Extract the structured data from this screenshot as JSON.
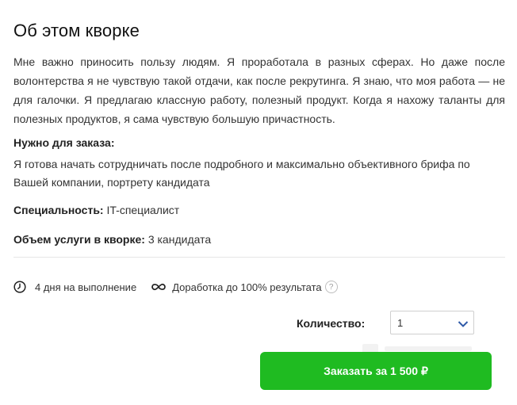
{
  "section": {
    "title": "Об этом кворке",
    "description": "Мне важно приносить пользу людям. Я проработала в разных сферах. Но даже после волонтерства я не чувствую такой отдачи, как после рекрутинга. Я знаю, что моя работа — не для галочки. Я предлагаю классную работу, полезный продукт. Когда я нахожу таланты для полезных продуктов, я сама чувствую большую причастность."
  },
  "requirements": {
    "title": "Нужно для заказа:",
    "text": "Я готова начать сотрудничать после подробного и максимально объективного брифа по Вашей компании, портрету кандидата"
  },
  "specialty": {
    "label": "Специальность:",
    "value": "IT-специалист"
  },
  "volume": {
    "label": "Объем услуги в кворке:",
    "value": "3 кандидата"
  },
  "meta": {
    "delivery": {
      "icon": "clock-icon",
      "text": "4 дня на выполнение"
    },
    "revisions": {
      "icon": "infinity-icon",
      "text": "Доработка до 100% результата",
      "help_icon": "question-icon",
      "help_glyph": "?"
    }
  },
  "order": {
    "quantity_label": "Количество:",
    "quantity_value": "1",
    "button_label": "Заказать за 1 500 ₽"
  },
  "colors": {
    "accent": "#1fbb21",
    "chevron": "#2f5aa8"
  }
}
